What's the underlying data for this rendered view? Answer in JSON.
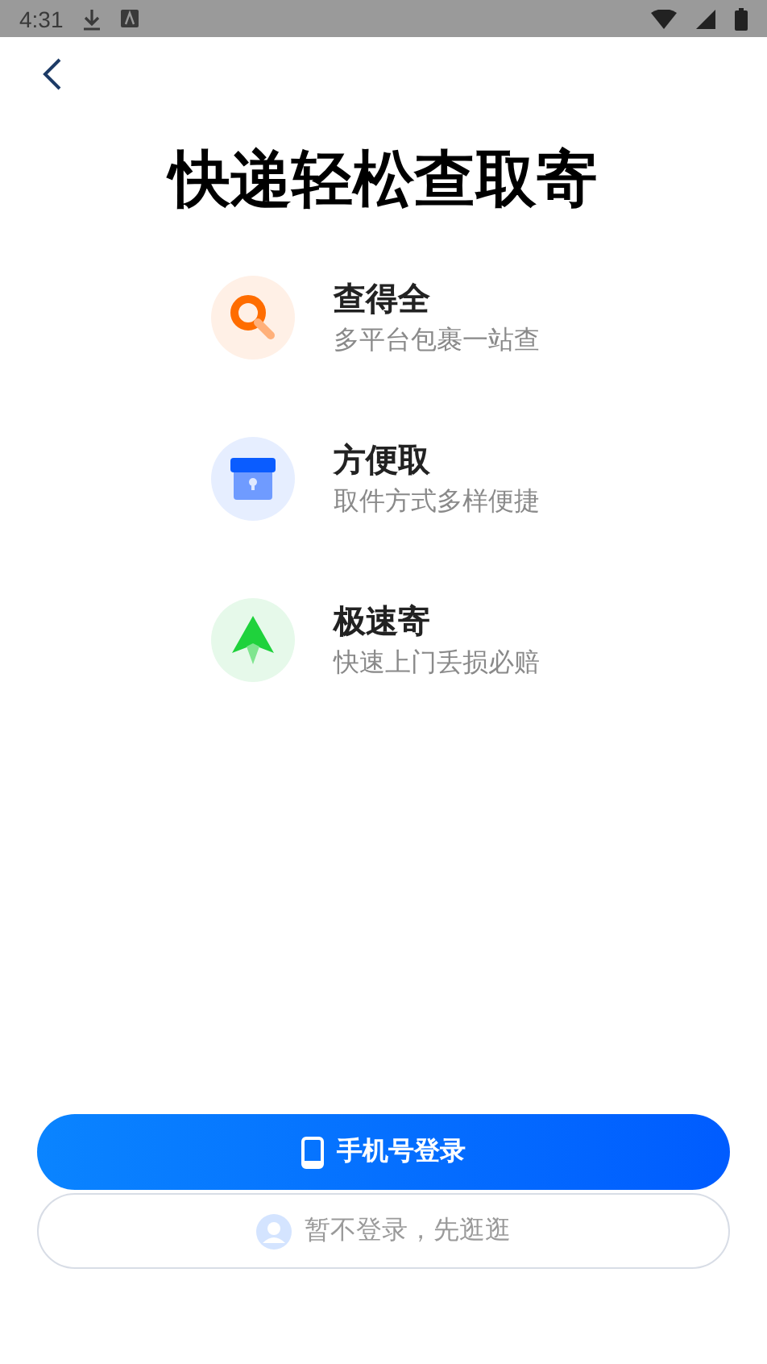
{
  "status_bar": {
    "time": "4:31"
  },
  "title": "快递轻松查取寄",
  "features": [
    {
      "kind": "search",
      "title": "查得全",
      "subtitle": "多平台包裹一站查"
    },
    {
      "kind": "locker",
      "title": "方便取",
      "subtitle": "取件方式多样便捷"
    },
    {
      "kind": "send",
      "title": "极速寄",
      "subtitle": "快速上门丢损必赔"
    }
  ],
  "buttons": [
    {
      "kind": "primary",
      "label": "手机号登录"
    },
    {
      "kind": "secondary",
      "label": "暂不登录，先逛逛"
    }
  ]
}
